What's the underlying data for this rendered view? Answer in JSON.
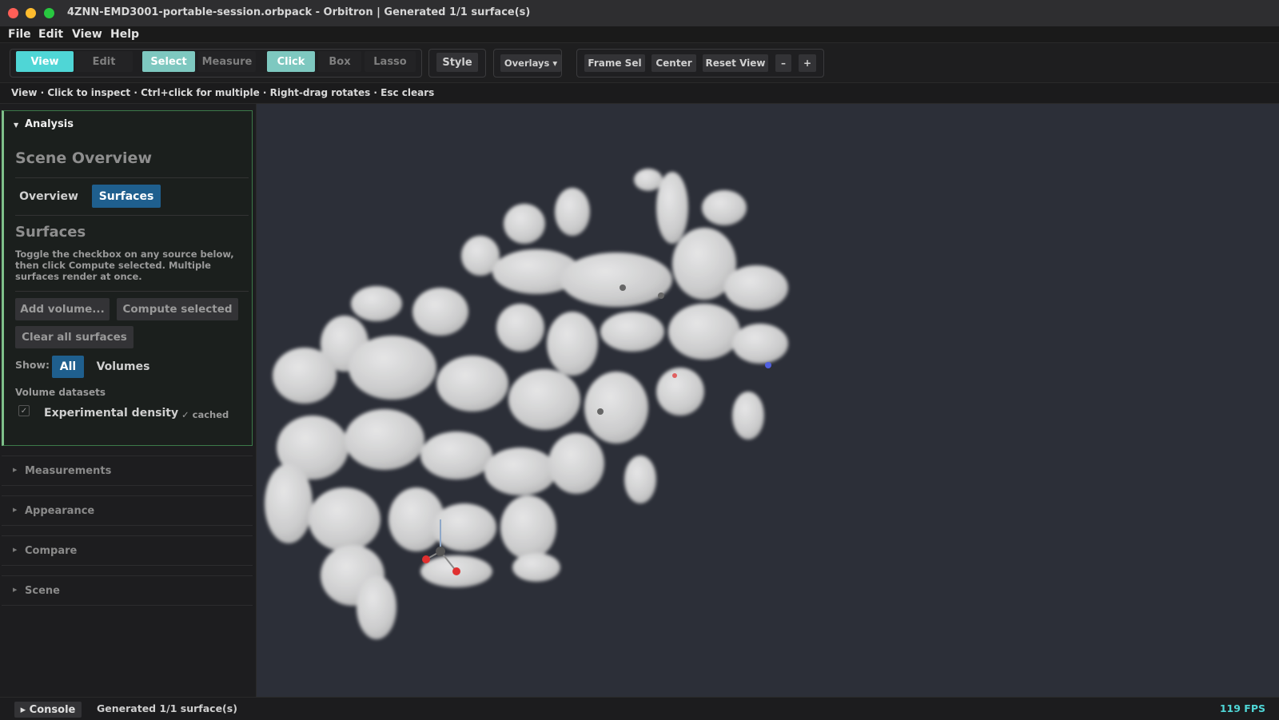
{
  "window": {
    "title": "4ZNN-EMD3001-portable-session.orbpack - Orbitron | Generated 1/1 surface(s)"
  },
  "menu": [
    "File",
    "Edit",
    "View",
    "Help"
  ],
  "toolbar": {
    "mode": {
      "view": "View",
      "edit": "Edit"
    },
    "tool": {
      "select": "Select",
      "measure": "Measure"
    },
    "selection": {
      "click": "Click",
      "box": "Box",
      "lasso": "Lasso"
    },
    "style": "Style",
    "overlays": "Overlays ▾",
    "camera": {
      "frame_sel": "Frame Sel",
      "center": "Center",
      "reset_view": "Reset View",
      "zoom_out": "–",
      "zoom_in": "+"
    }
  },
  "hint": "View · Click to inspect · Ctrl+click for multiple · Right-drag rotates · Esc clears",
  "sidebar": {
    "analysis": {
      "header": "Analysis",
      "scene_overview": "Scene Overview",
      "tabs": [
        "Overview",
        "Surfaces"
      ],
      "surfaces_title": "Surfaces",
      "description": "Toggle the checkbox on any source below, then click Compute selected. Multiple surfaces render at once.",
      "add_volume": "Add volume...",
      "compute_selected": "Compute selected",
      "clear_all": "Clear all surfaces",
      "show_label": "Show:",
      "show_options": [
        "All",
        "Volumes"
      ],
      "volume_datasets_label": "Volume datasets",
      "dataset": {
        "name": "Experimental density",
        "status": "✓ cached",
        "checked": true
      }
    },
    "sections": [
      "Measurements",
      "Appearance",
      "Compare",
      "Scene"
    ]
  },
  "statusbar": {
    "console": "▸ Console",
    "message": "Generated 1/1 surface(s)",
    "fps": "119 FPS"
  },
  "colors": {
    "accent_cyan": "#4fd6d6",
    "accent_teal": "#7ec8c0",
    "tab_active": "#1f5f8e",
    "viewport_bg": "#2c2f38",
    "surface": "#e6e6e6",
    "atom_oxygen": "#e03030",
    "atom_nitrogen": "#5060e0",
    "atom_carbon": "#555555"
  },
  "icons": {
    "section_expanded": "triangle-down-icon",
    "section_collapsed": "triangle-right-icon",
    "checkbox": "check-icon"
  }
}
